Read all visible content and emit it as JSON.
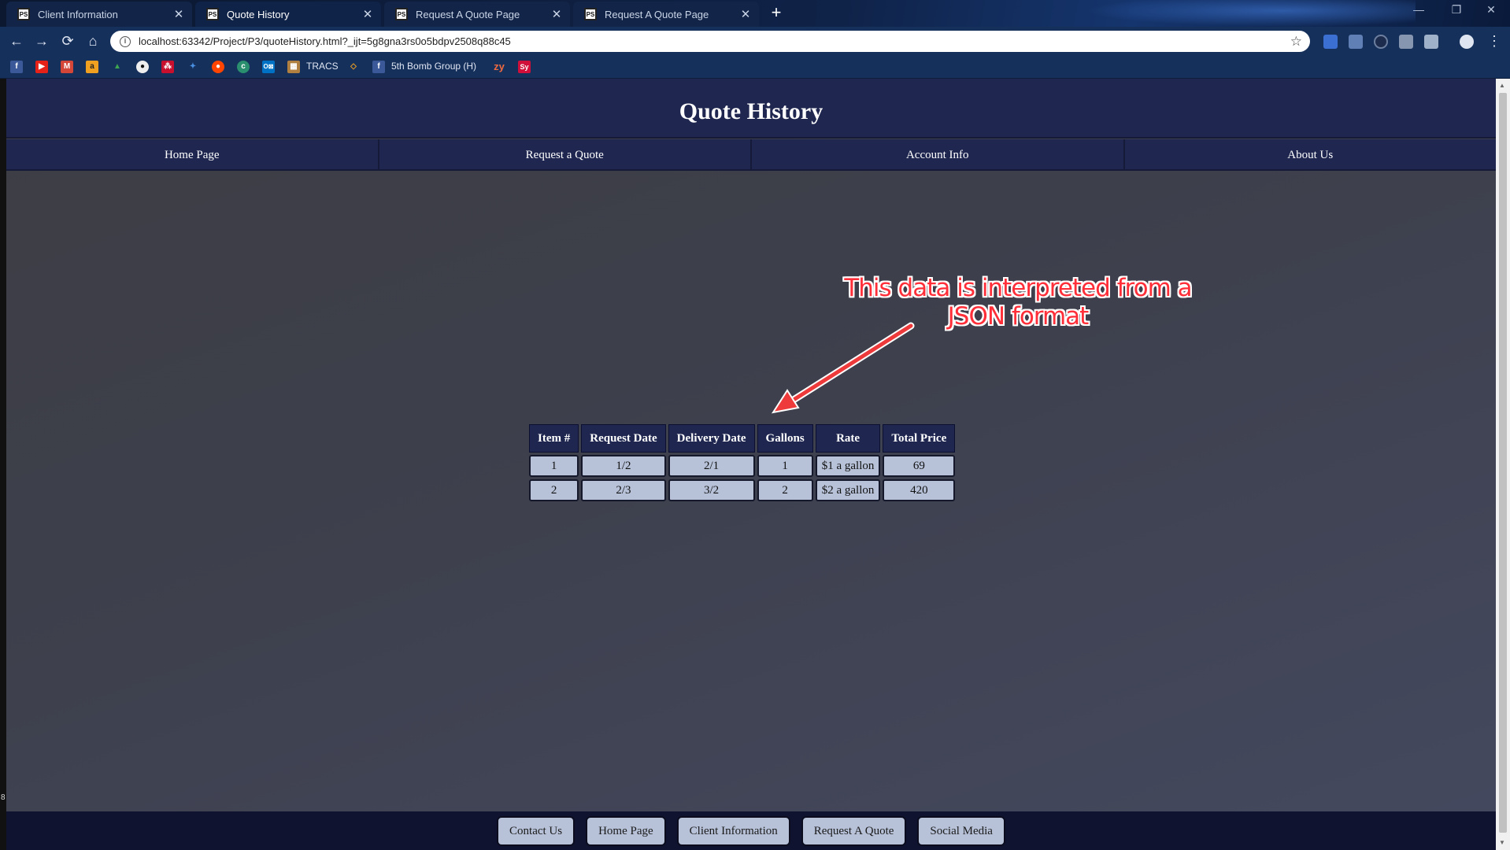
{
  "browser": {
    "tabs": [
      {
        "title": "Client Information",
        "favicon": "PS",
        "active": false
      },
      {
        "title": "Quote History",
        "favicon": "PS",
        "active": true
      },
      {
        "title": "Request A Quote Page",
        "favicon": "PS",
        "active": false
      },
      {
        "title": "Request A Quote Page",
        "favicon": "PS",
        "active": false
      }
    ],
    "url": "localhost:63342/Project/P3/quoteHistory.html?_ijt=5g8gna3rs0o5bdpv2508q88c45",
    "bookmarks": {
      "tracs": "TRACS",
      "bomb_group": "5th Bomb Group (H)",
      "zy": "zy",
      "sy": "Sy"
    }
  },
  "page": {
    "title": "Quote History",
    "nav": [
      "Home Page",
      "Request a Quote",
      "Account Info",
      "About Us"
    ],
    "annotation": {
      "line1": "This data is interpreted from a",
      "line2": "JSON format"
    },
    "table": {
      "headers": [
        "Item #",
        "Request Date",
        "Delivery Date",
        "Gallons",
        "Rate",
        "Total Price"
      ],
      "rows": [
        [
          "1",
          "1/2",
          "2/1",
          "1",
          "$1 a gallon",
          "69"
        ],
        [
          "2",
          "2/3",
          "3/2",
          "2",
          "$2 a gallon",
          "420"
        ]
      ]
    },
    "footer": [
      "Contact Us",
      "Home Page",
      "Client Information",
      "Request A Quote",
      "Social Media"
    ],
    "side_marker": "8"
  },
  "colors": {
    "header_bg": "#1f2750",
    "cell_bg": "#b7c2d9",
    "annotation": "#ff2f3a",
    "footer_bg": "#0f1330"
  }
}
